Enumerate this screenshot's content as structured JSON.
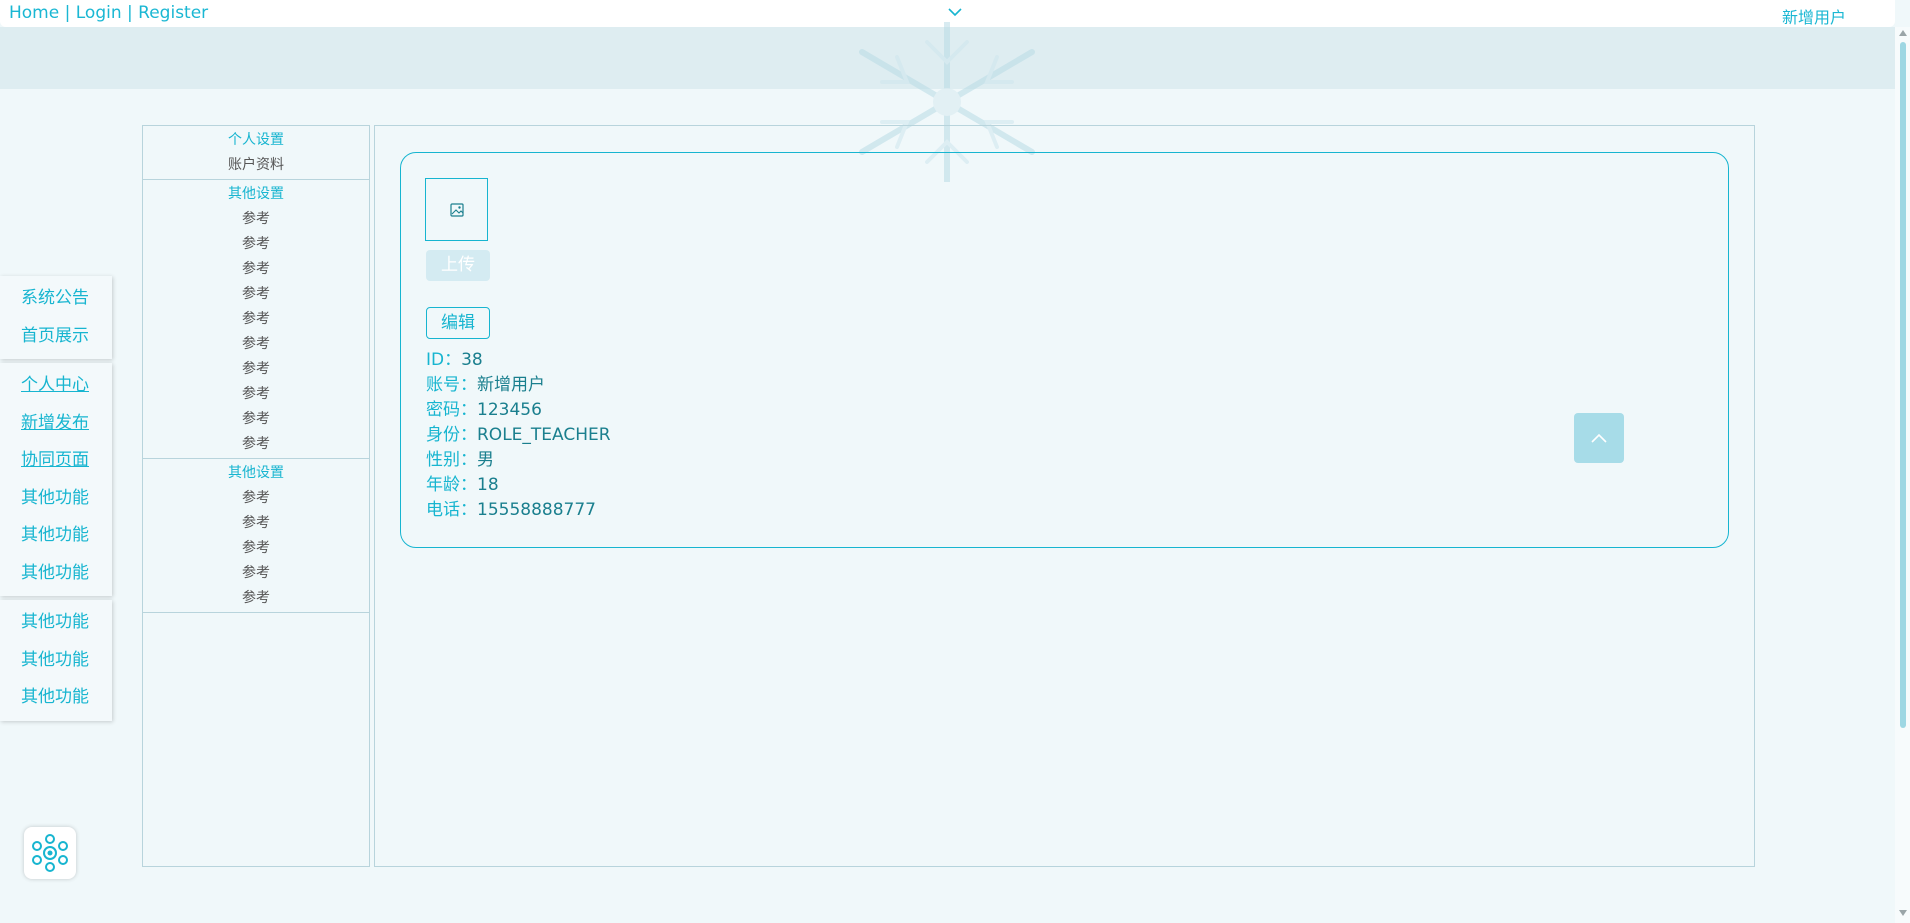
{
  "nav": {
    "home": "Home",
    "login": "Login",
    "register": "Register",
    "separator": "|",
    "user_name": "新增用户"
  },
  "float_menu": {
    "groups": [
      [
        "系统公告",
        "首页展示"
      ],
      [
        "个人中心",
        "新增发布",
        "协同页面",
        "其他功能",
        "其他功能",
        "其他功能"
      ],
      [
        "其他功能",
        "其他功能",
        "其他功能"
      ]
    ]
  },
  "settings_menu": {
    "sections": [
      {
        "title": "个人设置",
        "items": [
          "账户资料"
        ]
      },
      {
        "title": "其他设置",
        "items": [
          "参考",
          "参考",
          "参考",
          "参考",
          "参考",
          "参考",
          "参考",
          "参考",
          "参考",
          "参考"
        ]
      },
      {
        "title": "其他设置",
        "items": [
          "参考",
          "参考",
          "参考",
          "参考",
          "参考"
        ]
      }
    ]
  },
  "profile": {
    "upload_label": "上传",
    "edit_label": "编辑",
    "fields": [
      {
        "label": "ID：",
        "value": "38"
      },
      {
        "label": "账号：",
        "value": "新增用户"
      },
      {
        "label": "密码：",
        "value": "123456"
      },
      {
        "label": "身份：",
        "value": "ROLE_TEACHER"
      },
      {
        "label": "性别：",
        "value": "男"
      },
      {
        "label": "年龄：",
        "value": "18"
      },
      {
        "label": "电话：",
        "value": "15558888777"
      }
    ]
  },
  "icons": {
    "chevron": "chevron-down-icon",
    "avatar_placeholder": "image-icon",
    "back_to_top": "chevron-up-icon",
    "logo": "snowflake-logo-icon"
  },
  "colors": {
    "accent": "#17b5d0",
    "background": "#f0f8fa",
    "banner": "#deedf1",
    "back_to_top": "#a7dce8"
  }
}
